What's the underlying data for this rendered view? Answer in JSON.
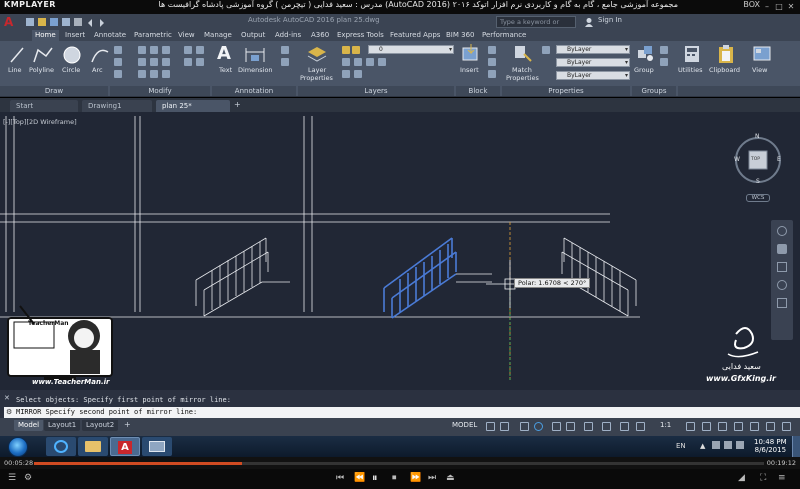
{
  "kmplayer": {
    "logo": "KMPLAYER",
    "title": "مجموعه آموزشی جامع ، گام به گام و کاربردی نرم افزار اتوکد ۲۰۱۶ (AutoCAD 2016) مدرس : سعید فدایی ( تیچرمن ) گروه آموزشی پادشاه گرافیست ها",
    "box_label": "BOX",
    "time_elapsed": "00:05:28",
    "time_total": "00:19:12",
    "progress_fraction": 0.285
  },
  "acad": {
    "doc_title": "Autodesk AutoCAD 2016   plan 25.dwg",
    "search_placeholder": "Type a keyword or phrase",
    "sign_in": "Sign In",
    "menu_tabs": [
      "Home",
      "Insert",
      "Annotate",
      "Parametric",
      "View",
      "Manage",
      "Output",
      "Add-ins",
      "A360",
      "Express Tools",
      "Featured Apps",
      "BIM 360",
      "Performance"
    ],
    "ribbon": {
      "tools": {
        "line": "Line",
        "polyline": "Polyline",
        "circle": "Circle",
        "arc": "Arc",
        "text": "Text",
        "dimension": "Dimension",
        "layer_properties_1": "Layer",
        "layer_properties_2": "Properties",
        "insert": "Insert",
        "match_1": "Match",
        "match_2": "Properties",
        "group": "Group",
        "utilities": "Utilities",
        "clipboard": "Clipboard",
        "view": "View"
      },
      "groups": [
        "Draw",
        "Modify",
        "Annotation",
        "Layers",
        "Block",
        "Properties",
        "Groups"
      ],
      "layer_dropdown": "0",
      "bylayer_1": "ByLayer",
      "bylayer_2": "ByLayer",
      "bylayer_3": "ByLayer"
    },
    "doc_tabs": [
      "Start",
      "Drawing1",
      "plan 25*"
    ],
    "viewport_label": "[-][Top][2D Wireframe]",
    "viewcube": {
      "n": "N",
      "s": "S",
      "e": "E",
      "w": "W",
      "face": "TOP",
      "wcs": "WCS"
    },
    "polar_tooltip": "Polar: 1.6708 < 270°",
    "command_history": "Select objects:  Specify first point of mirror line:",
    "command_input": "MIRROR Specify second point of mirror line:",
    "layout_tabs": [
      "Model",
      "Layout1",
      "Layout2"
    ],
    "status": {
      "model": "MODEL",
      "scale": "1:1"
    }
  },
  "watermark": {
    "teacher_url": "www.TeacherMan.ir",
    "teacher_brand": "TeacherMan",
    "gfx_url": "www.GfxKing.ir",
    "signature": "سعید فدایی"
  },
  "taskbar": {
    "lang": "EN",
    "time": "10:48 PM",
    "date": "8/6/2015"
  },
  "colors": {
    "drawing_bg": "#212735",
    "highlight": "#4a7bd6",
    "ribbon_bg": "#4a5567",
    "accent_red": "#c8272d"
  }
}
